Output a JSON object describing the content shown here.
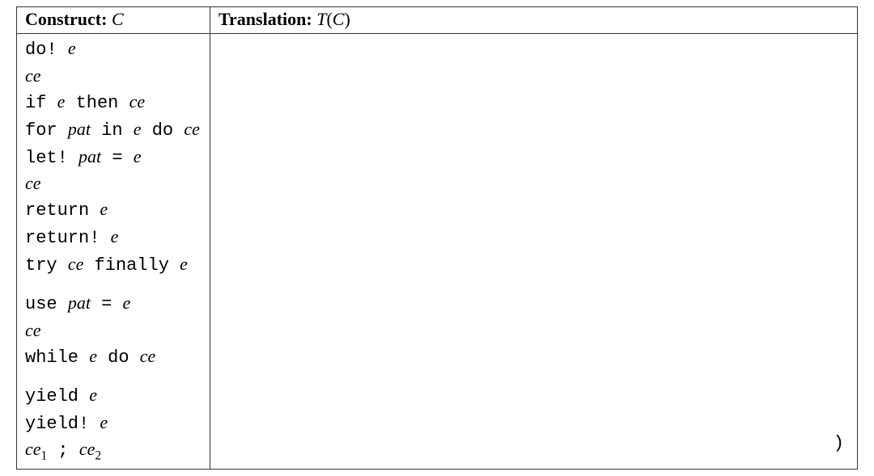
{
  "header": {
    "construct_label": "Construct",
    "construct_var": "C",
    "translation_label": "Translation",
    "translation_fn": "T",
    "translation_arg": "C"
  },
  "rows": [
    {
      "kind": "code",
      "parts": [
        {
          "t": "tt",
          "s": "do! "
        },
        {
          "t": "it",
          "s": "e"
        }
      ]
    },
    {
      "kind": "code",
      "parts": [
        {
          "t": "it",
          "s": "ce"
        }
      ]
    },
    {
      "kind": "code",
      "parts": [
        {
          "t": "tt",
          "s": "if "
        },
        {
          "t": "it",
          "s": "e"
        },
        {
          "t": "tt",
          "s": " then "
        },
        {
          "t": "it",
          "s": "ce"
        }
      ]
    },
    {
      "kind": "code",
      "parts": [
        {
          "t": "tt",
          "s": "for "
        },
        {
          "t": "it",
          "s": "pat"
        },
        {
          "t": "tt",
          "s": " in "
        },
        {
          "t": "it",
          "s": "e"
        },
        {
          "t": "tt",
          "s": " do "
        },
        {
          "t": "it",
          "s": "ce"
        }
      ]
    },
    {
      "kind": "code",
      "parts": [
        {
          "t": "tt",
          "s": "let! "
        },
        {
          "t": "it",
          "s": "pat"
        },
        {
          "t": "tt",
          "s": " = "
        },
        {
          "t": "it",
          "s": "e"
        }
      ]
    },
    {
      "kind": "code",
      "parts": [
        {
          "t": "it",
          "s": "ce"
        }
      ]
    },
    {
      "kind": "code",
      "parts": [
        {
          "t": "tt",
          "s": "return "
        },
        {
          "t": "it",
          "s": "e"
        }
      ]
    },
    {
      "kind": "code",
      "parts": [
        {
          "t": "tt",
          "s": "return! "
        },
        {
          "t": "it",
          "s": "e"
        }
      ]
    },
    {
      "kind": "code",
      "parts": [
        {
          "t": "tt",
          "s": "try "
        },
        {
          "t": "it",
          "s": "ce"
        },
        {
          "t": "tt",
          "s": " finally "
        },
        {
          "t": "it",
          "s": "e"
        }
      ]
    },
    {
      "kind": "gap"
    },
    {
      "kind": "code",
      "parts": [
        {
          "t": "tt",
          "s": "use "
        },
        {
          "t": "it",
          "s": "pat"
        },
        {
          "t": "tt",
          "s": " = "
        },
        {
          "t": "it",
          "s": "e"
        }
      ]
    },
    {
      "kind": "code",
      "parts": [
        {
          "t": "it",
          "s": "ce"
        }
      ]
    },
    {
      "kind": "code",
      "parts": [
        {
          "t": "tt",
          "s": "while "
        },
        {
          "t": "it",
          "s": "e"
        },
        {
          "t": "tt",
          "s": " do "
        },
        {
          "t": "it",
          "s": "ce"
        }
      ]
    },
    {
      "kind": "gap"
    },
    {
      "kind": "code",
      "parts": [
        {
          "t": "tt",
          "s": "yield "
        },
        {
          "t": "it",
          "s": "e"
        }
      ]
    },
    {
      "kind": "code",
      "parts": [
        {
          "t": "tt",
          "s": "yield! "
        },
        {
          "t": "it",
          "s": "e"
        }
      ]
    },
    {
      "kind": "code",
      "parts": [
        {
          "t": "it",
          "s": "ce"
        },
        {
          "t": "sub",
          "s": "1"
        },
        {
          "t": "tt",
          "s": " ; "
        },
        {
          "t": "it",
          "s": "ce"
        },
        {
          "t": "sub",
          "s": "2"
        }
      ]
    }
  ],
  "trailing_paren": ")"
}
